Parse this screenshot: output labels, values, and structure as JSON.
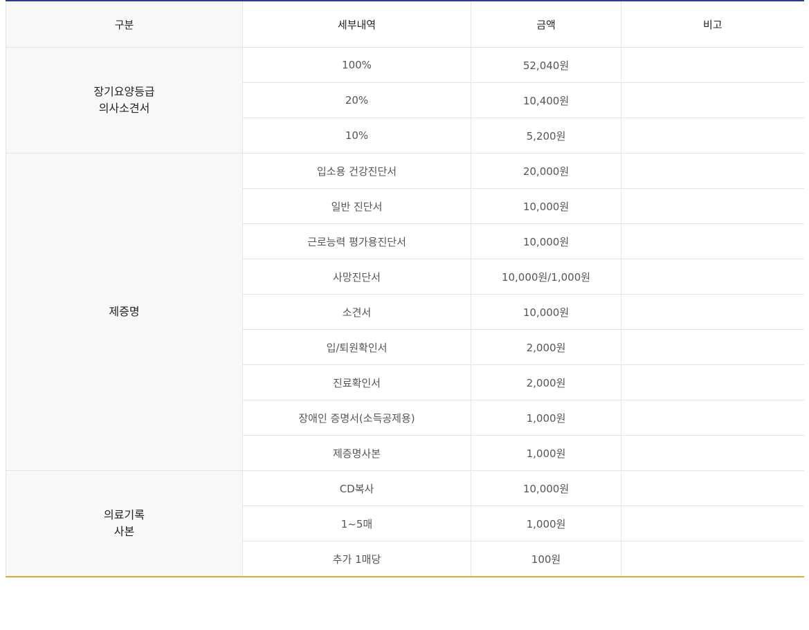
{
  "headers": {
    "category": "구분",
    "detail": "세부내역",
    "amount": "금액",
    "note": "비고"
  },
  "groups": [
    {
      "category_lines": [
        "장기요양등급",
        "의사소견서"
      ],
      "rows": [
        {
          "detail": "100%",
          "amount": "52,040원",
          "note": ""
        },
        {
          "detail": "20%",
          "amount": "10,400원",
          "note": ""
        },
        {
          "detail": "10%",
          "amount": "5,200원",
          "note": ""
        }
      ]
    },
    {
      "category_lines": [
        "제증명"
      ],
      "rows": [
        {
          "detail": "입소용 건강진단서",
          "amount": "20,000원",
          "note": ""
        },
        {
          "detail": "일반 진단서",
          "amount": "10,000원",
          "note": ""
        },
        {
          "detail": "근로능력 평가용진단서",
          "amount": "10,000원",
          "note": ""
        },
        {
          "detail": "사망진단서",
          "amount": "10,000원/1,000원",
          "note": ""
        },
        {
          "detail": "소견서",
          "amount": "10,000원",
          "note": ""
        },
        {
          "detail": "입/퇴원확인서",
          "amount": "2,000원",
          "note": ""
        },
        {
          "detail": "진료확인서",
          "amount": "2,000원",
          "note": ""
        },
        {
          "detail": "장애인 증명서(소득공제용)",
          "amount": "1,000원",
          "note": ""
        },
        {
          "detail": "제증명사본",
          "amount": "1,000원",
          "note": ""
        }
      ]
    },
    {
      "category_lines": [
        "의료기록",
        "사본"
      ],
      "rows": [
        {
          "detail": "CD복사",
          "amount": "10,000원",
          "note": ""
        },
        {
          "detail": "1~5매",
          "amount": "1,000원",
          "note": ""
        },
        {
          "detail": "추가 1매당",
          "amount": "100원",
          "note": ""
        }
      ]
    }
  ],
  "colors": {
    "top_border": "#2a3a8c",
    "bottom_border": "#e5a92a",
    "category_bg": "#f8f8f8",
    "grid": "#e4e4e4"
  }
}
